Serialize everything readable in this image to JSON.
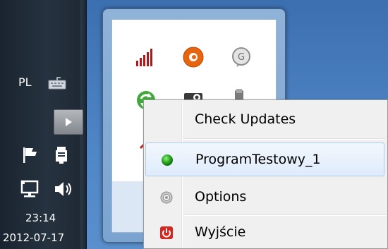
{
  "taskbar": {
    "language": "PL",
    "time": "23:14",
    "date": "2012-07-17",
    "icons": [
      "keyboard-icon",
      "show-hidden-icons-button",
      "action-center-flag-icon",
      "safely-remove-hardware-icon",
      "network-icon",
      "volume-icon"
    ]
  },
  "tray_flyout": {
    "icons": [
      "signal-bars-icon",
      "orange-g-icon",
      "gray-g-icon",
      "green-sync-icon",
      "steam-icon",
      "usb-device-icon",
      "red-tool-icon"
    ]
  },
  "context_menu": {
    "items": [
      {
        "label": "Check Updates",
        "icon": ""
      },
      {
        "label": "ProgramTestowy_1",
        "icon": "green-dot-icon",
        "highlighted": true
      },
      {
        "label": "Options",
        "icon": "gear-icon"
      },
      {
        "label": "Wyjście",
        "icon": "power-icon"
      }
    ]
  },
  "colors": {
    "menu_bg": "#f0f0f0",
    "highlight_bg": "#dfebfb",
    "highlight_border": "#aeccf1",
    "taskbar_bg": "#1e2833",
    "flyout_border": "#46638a"
  }
}
